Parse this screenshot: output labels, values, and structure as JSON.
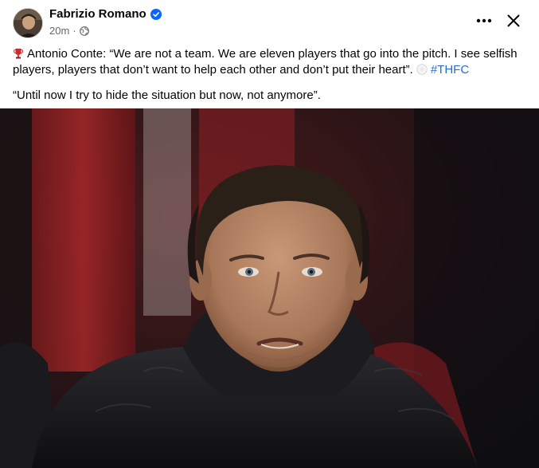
{
  "post": {
    "author": "Fabrizio Romano",
    "time": "20m",
    "separator": "·",
    "text_intro": "Antonio Conte: “We are not a team. We are eleven players that go into the pitch. I see selfish players, players that don’t want to help each other and don’t put their heart”.",
    "hashtag": "#THFC",
    "text_second": "“Until now I try to hide the situation but now, not anymore”."
  },
  "icons": {
    "verified": "verified-badge-icon",
    "audience": "globe-icon",
    "more": "more-options-icon",
    "close": "close-icon",
    "trophy": "trophy-emoji-icon",
    "ball": "football-emoji-icon"
  },
  "colors": {
    "link": "#216fdb",
    "verified": "#0866ff",
    "meta": "#65676b"
  }
}
